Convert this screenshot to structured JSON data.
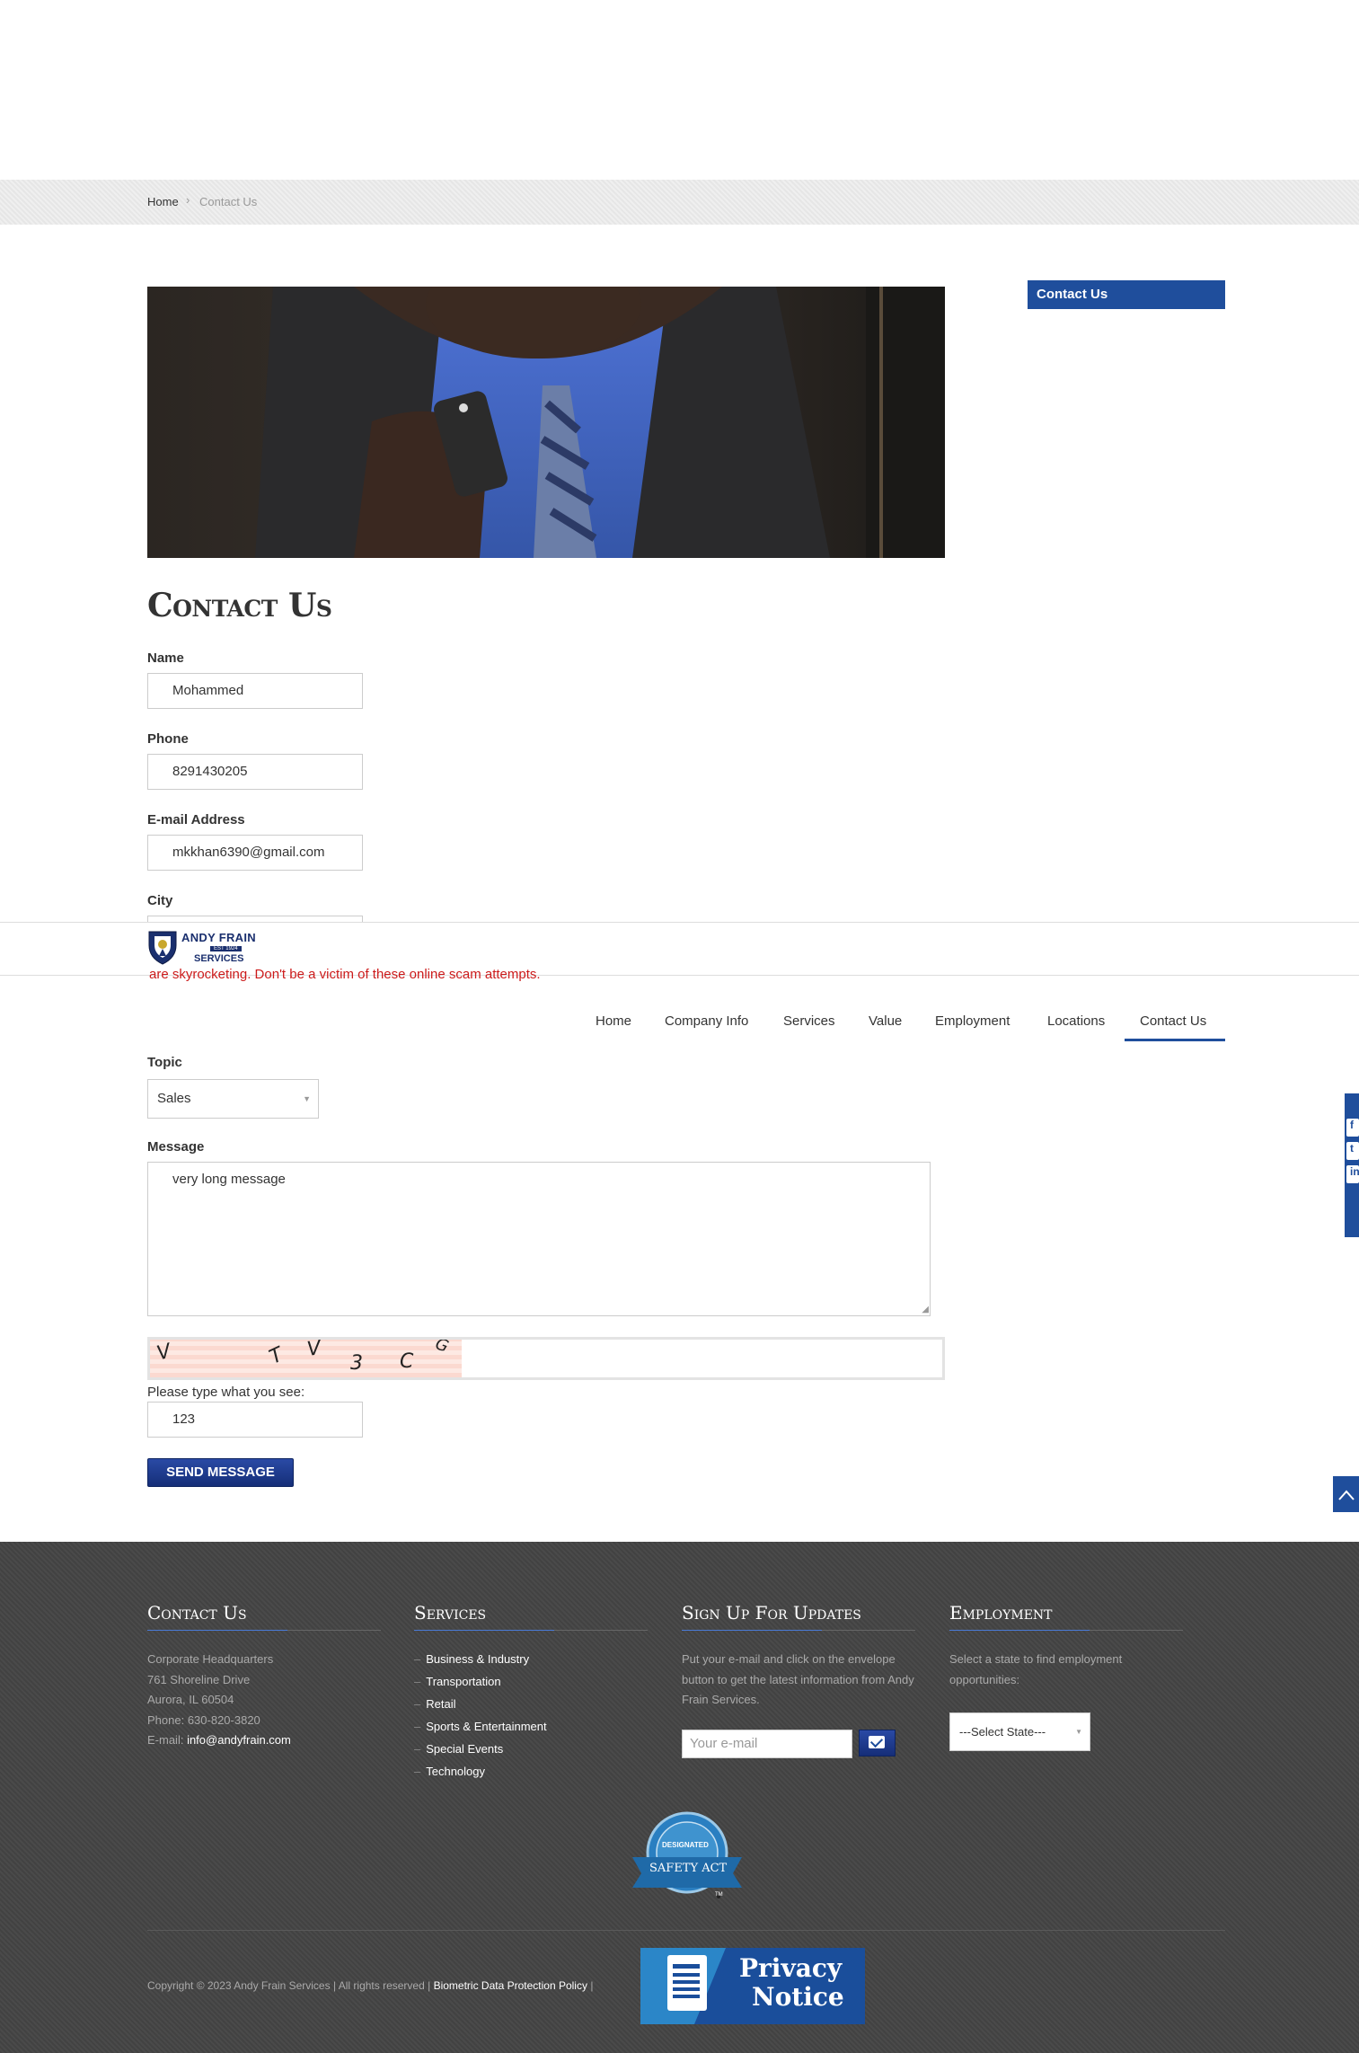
{
  "breadcrumb": {
    "home": "Home",
    "separator": "›",
    "current": "Contact Us"
  },
  "sidebar": {
    "contact_us": "Contact Us"
  },
  "page": {
    "title": "Contact Us"
  },
  "form": {
    "name_label": "Name",
    "name_value": "Mohammed",
    "phone_label": "Phone",
    "phone_value": "8291430205",
    "email_label": "E-mail Address",
    "email_value": "mkkhan6390@gmail.com",
    "city_label": "City",
    "topic_label": "Topic",
    "topic_value": "Sales",
    "message_label": "Message",
    "message_value": "very long message",
    "captcha_chars": [
      "V",
      "T",
      "V",
      "3",
      "C",
      "G"
    ],
    "captcha_label": "Please type what you see:",
    "captcha_value": "123",
    "send_label": "SEND MESSAGE"
  },
  "header": {
    "logo_text": "ANDY FRAIN",
    "logo_est": "EST 1924",
    "logo_services": "SERVICES",
    "alert": "are skyrocketing. Don't be a victim of these online scam attempts."
  },
  "nav": [
    {
      "label": "Home"
    },
    {
      "label": "Company Info"
    },
    {
      "label": "Services"
    },
    {
      "label": "Value"
    },
    {
      "label": "Employment"
    },
    {
      "label": "Locations"
    },
    {
      "label": "Contact Us",
      "active": true
    }
  ],
  "footer": {
    "contact": {
      "heading": "Contact Us",
      "line1": "Corporate Headquarters",
      "line2": "761 Shoreline Drive",
      "line3": "Aurora, IL  60504",
      "line4": "Phone: 630-820-3820",
      "email_prefix": "E-mail: ",
      "email": "info@andyfrain.com"
    },
    "services": {
      "heading": "Services",
      "items": [
        "Business & Industry",
        "Transportation",
        "Retail",
        "Sports & Entertainment",
        "Special Events",
        "Technology"
      ]
    },
    "signup": {
      "heading": "Sign Up For Updates",
      "text": "Put your e-mail and click on the envelope button to get the latest information from Andy Frain Services.",
      "placeholder": "Your e-mail"
    },
    "employment": {
      "heading": "Employment",
      "text": "Select a state to find employment opportunities:",
      "select_value": "---Select State---"
    },
    "badge": {
      "top": "DESIGNATED",
      "main": "SAFETY ACT",
      "tm": "TM"
    },
    "copyright": "Copyright © 2023 Andy Frain Services | All rights reserved |",
    "biometric_link": "Biometric Data Protection Policy",
    "pipe": "|",
    "privacy_line1": "Privacy",
    "privacy_line2": "Notice"
  },
  "colors": {
    "brand_blue": "#1f4e9c",
    "alert_red": "#cc1a1a",
    "footer_bg": "#444444"
  },
  "icons": {
    "back_to_top": "chevron-up-icon",
    "social": [
      "facebook-icon",
      "twitter-icon",
      "linkedin-icon"
    ],
    "email": "envelope-icon"
  }
}
